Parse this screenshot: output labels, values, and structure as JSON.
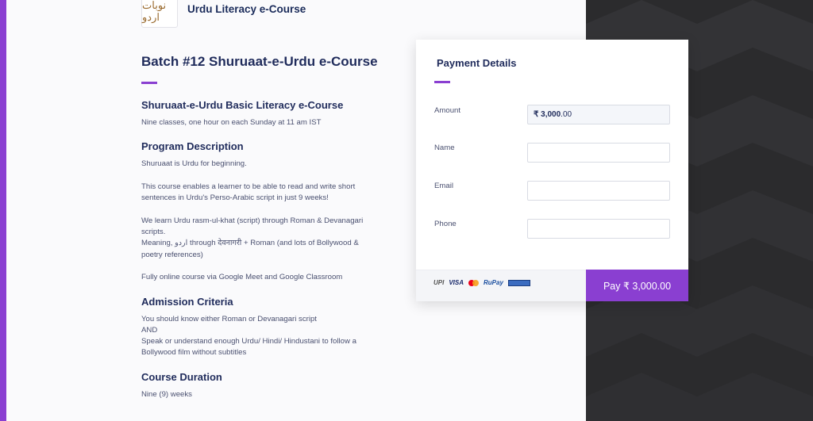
{
  "header": {
    "logo_text": "نوبات اردو",
    "org_name": "Urdu Literacy e-Course"
  },
  "course": {
    "title": "Batch #12 Shuruaat-e-Urdu e-Course",
    "subtitle": "Shuruaat-e-Urdu Basic Literacy e-Course",
    "schedule": "Nine classes, one hour on each Sunday at 11 am IST",
    "program_heading": "Program Description",
    "program_p1": "Shuruaat is Urdu for beginning.",
    "program_p2": "This course enables a learner to be able to read and write short sentences in Urdu's Perso-Arabic script in just 9 weeks!",
    "program_p3_line1": "We learn Urdu rasm-ul-khat (script) through Roman & Devanagari scripts.",
    "program_p3_line2": "Meaning, اردو through देवनागरी + Roman (and lots of Bollywood & poetry references)",
    "program_p4": "Fully online course via Google Meet and Google Classroom",
    "admission_heading": "Admission Criteria",
    "admission_line1": "You should know either Roman or Devanagari script",
    "admission_line2": "AND",
    "admission_line3": "Speak or understand enough Urdu/ Hindi/ Hindustani to follow a Bollywood film without subtitles",
    "duration_heading": "Course Duration",
    "duration_value": "Nine (9) weeks"
  },
  "payment": {
    "title": "Payment Details",
    "amount_label": "Amount",
    "amount_currency": "₹ 3,000",
    "amount_decimal": ".00",
    "name_label": "Name",
    "name_value": "",
    "email_label": "Email",
    "email_value": "",
    "phone_label": "Phone",
    "phone_value": "",
    "methods": [
      "UPI",
      "VISA",
      "MasterCard",
      "RuPay",
      "NetBanking"
    ],
    "method_labels": {
      "upi": "UPI",
      "visa": "VISA",
      "rupay": "RuPay"
    },
    "pay_button": "Pay  ₹ 3,000.00"
  },
  "colors": {
    "accent": "#8a3fd1",
    "text_dark": "#1f2b5b",
    "dark_panel": "#2a2a2c"
  }
}
